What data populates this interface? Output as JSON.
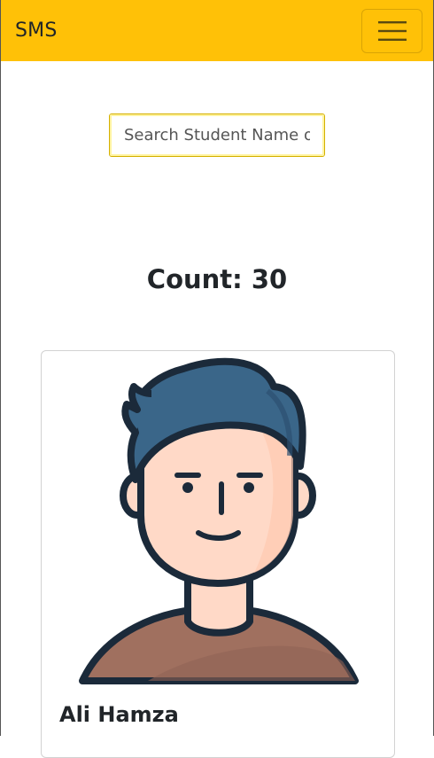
{
  "navbar": {
    "brand": "SMS",
    "menu_icon": "hamburger-menu-icon",
    "background_color": "#ffc107"
  },
  "search": {
    "placeholder": "Search Student Name o",
    "value": ""
  },
  "count_label": "Count: 30",
  "students": [
    {
      "name": "Ali Hamza",
      "avatar_icon": "male-student-avatar"
    }
  ]
}
